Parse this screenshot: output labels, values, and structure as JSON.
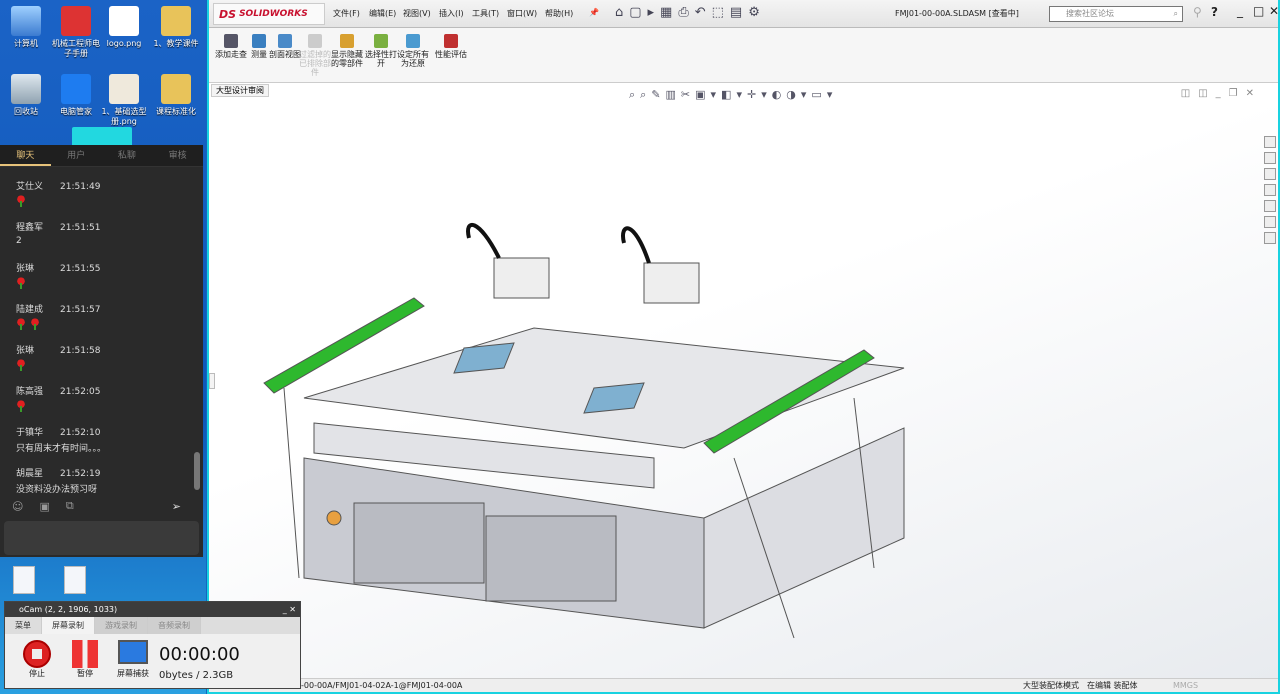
{
  "desktop": {
    "icons": [
      "计算机",
      "机械工程师电子手册",
      "logo.png",
      "1、教学课件",
      "回收站",
      "电脑管家",
      "1、基础选型册.png",
      "课程标准化"
    ]
  },
  "chat": {
    "tabs": [
      "聊天",
      "用户",
      "私聊",
      "审核"
    ],
    "messages": [
      {
        "name": "艾仕义",
        "time": "21:51:49",
        "roses": 1,
        "text": ""
      },
      {
        "name": "程鑫军",
        "time": "21:51:51",
        "roses": 0,
        "text": "2"
      },
      {
        "name": "张琳",
        "time": "21:51:55",
        "roses": 1,
        "text": ""
      },
      {
        "name": "陆建成",
        "time": "21:51:57",
        "roses": 2,
        "text": ""
      },
      {
        "name": "张琳",
        "time": "21:51:58",
        "roses": 1,
        "text": ""
      },
      {
        "name": "陈高强",
        "time": "21:52:05",
        "roses": 1,
        "text": ""
      },
      {
        "name": "于镇华",
        "time": "21:52:10",
        "roses": 0,
        "text": "只有周末才有时间。。。"
      },
      {
        "name": "胡晨星",
        "time": "21:52:19",
        "roses": 0,
        "text": "没资料没办法预习呀"
      }
    ]
  },
  "ocam": {
    "title": "oCam (2, 2, 1906, 1033)",
    "tabs": [
      "菜单",
      "屏幕录制",
      "游戏录制",
      "音频录制"
    ],
    "stop": "停止",
    "pause": "暂停",
    "capture": "屏幕捕获",
    "timer": "00:00:00",
    "size": "0bytes / 2.3GB"
  },
  "solidworks": {
    "logo": "SOLIDWORKS",
    "menu": [
      "文件(F)",
      "编辑(E)",
      "视图(V)",
      "插入(I)",
      "工具(T)",
      "窗口(W)",
      "帮助(H)"
    ],
    "doc_title": "FMJ01-00-00A.SLDASM [查看中]",
    "search_placeholder": "搜索社区论坛",
    "commands": [
      "添加走查",
      "测量",
      "剖面视图",
      "过滤掉的已排除部件",
      "显示隐藏的零部件",
      "选择性打开",
      "设定所有为还原",
      "性能评估"
    ],
    "view_tab": "大型设计审阅",
    "status_path": "-00-00A/FMJ01-04-02A-1@FMJ01-04-00A",
    "status_mode": "大型装配体模式",
    "status_edit": "在编辑 装配体",
    "status_units": "MMGS"
  }
}
